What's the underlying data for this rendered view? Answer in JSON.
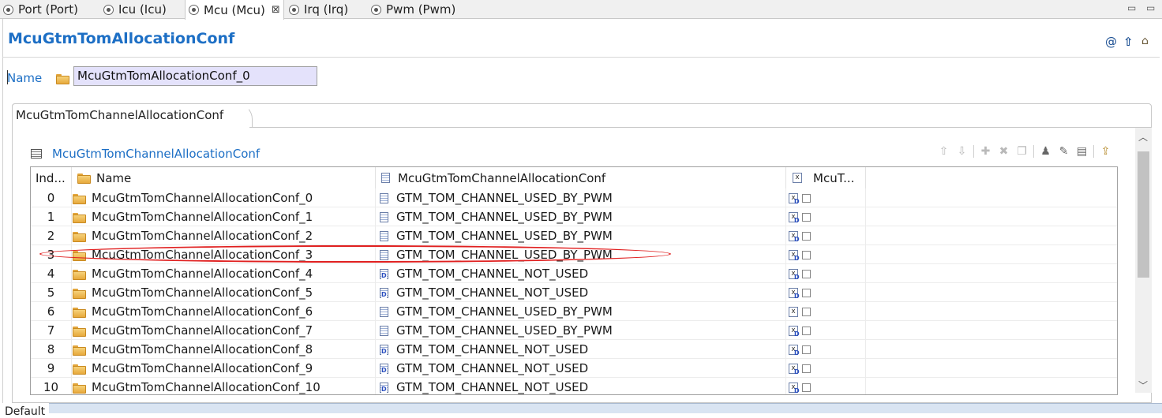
{
  "tabs": [
    {
      "label": "Port (Port)",
      "active": false
    },
    {
      "label": "Icu (Icu)",
      "active": false
    },
    {
      "label": "Mcu (Mcu)",
      "active": true,
      "close": "⊠"
    },
    {
      "label": "Irq (Irq)",
      "active": false
    },
    {
      "label": "Pwm (Pwm)",
      "active": false
    }
  ],
  "window_controls": {
    "minimize": "▭",
    "maximize": "▭"
  },
  "header": {
    "title": "McuGtmTomAllocationConf",
    "icons": [
      "at-icon",
      "up-arrow-icon",
      "home-icon"
    ]
  },
  "name_field": {
    "label": "Name",
    "value": "McuGtmTomAllocationConf_0"
  },
  "section": {
    "tab_label": "McuGtmTomChannelAllocationConf",
    "table_title": "McuGtmTomChannelAllocationConf"
  },
  "toolbar": {
    "icons": [
      "move-up-icon",
      "move-down-icon",
      "add-icon",
      "delete-icon",
      "copy-icon",
      "user-icon",
      "edit-icon",
      "properties-icon",
      "export-icon"
    ]
  },
  "table": {
    "columns": [
      "Ind...",
      "Name",
      "McuGtmTomChannelAllocationConf",
      "McuT..."
    ],
    "rows": [
      {
        "index": "0",
        "name": "McuGtmTomChannelAllocationConf_0",
        "value": "GTM_TOM_CHANNEL_USED_BY_PWM",
        "value_default": false,
        "flag_default": true
      },
      {
        "index": "1",
        "name": "McuGtmTomChannelAllocationConf_1",
        "value": "GTM_TOM_CHANNEL_USED_BY_PWM",
        "value_default": false,
        "flag_default": true
      },
      {
        "index": "2",
        "name": "McuGtmTomChannelAllocationConf_2",
        "value": "GTM_TOM_CHANNEL_USED_BY_PWM",
        "value_default": false,
        "flag_default": true
      },
      {
        "index": "3",
        "name": "McuGtmTomChannelAllocationConf_3",
        "value": "GTM_TOM_CHANNEL_USED_BY_PWM",
        "value_default": false,
        "flag_default": true
      },
      {
        "index": "4",
        "name": "McuGtmTomChannelAllocationConf_4",
        "value": "GTM_TOM_CHANNEL_NOT_USED",
        "value_default": true,
        "flag_default": true
      },
      {
        "index": "5",
        "name": "McuGtmTomChannelAllocationConf_5",
        "value": "GTM_TOM_CHANNEL_NOT_USED",
        "value_default": true,
        "flag_default": true
      },
      {
        "index": "6",
        "name": "McuGtmTomChannelAllocationConf_6",
        "value": "GTM_TOM_CHANNEL_USED_BY_PWM",
        "value_default": false,
        "flag_default": false
      },
      {
        "index": "7",
        "name": "McuGtmTomChannelAllocationConf_7",
        "value": "GTM_TOM_CHANNEL_USED_BY_PWM",
        "value_default": false,
        "flag_default": true
      },
      {
        "index": "8",
        "name": "McuGtmTomChannelAllocationConf_8",
        "value": "GTM_TOM_CHANNEL_NOT_USED",
        "value_default": true,
        "flag_default": true
      },
      {
        "index": "9",
        "name": "McuGtmTomChannelAllocationConf_9",
        "value": "GTM_TOM_CHANNEL_NOT_USED",
        "value_default": true,
        "flag_default": true
      },
      {
        "index": "10",
        "name": "McuGtmTomChannelAllocationConf_10",
        "value": "GTM_TOM_CHANNEL_NOT_USED",
        "value_default": true,
        "flag_default": true
      }
    ]
  },
  "highlight": {
    "color": "#e02020"
  },
  "bottom_tab": {
    "label": "Default"
  },
  "colors": {
    "accent": "#1d6fc5",
    "name_input_bg": "#e4e2fb"
  }
}
